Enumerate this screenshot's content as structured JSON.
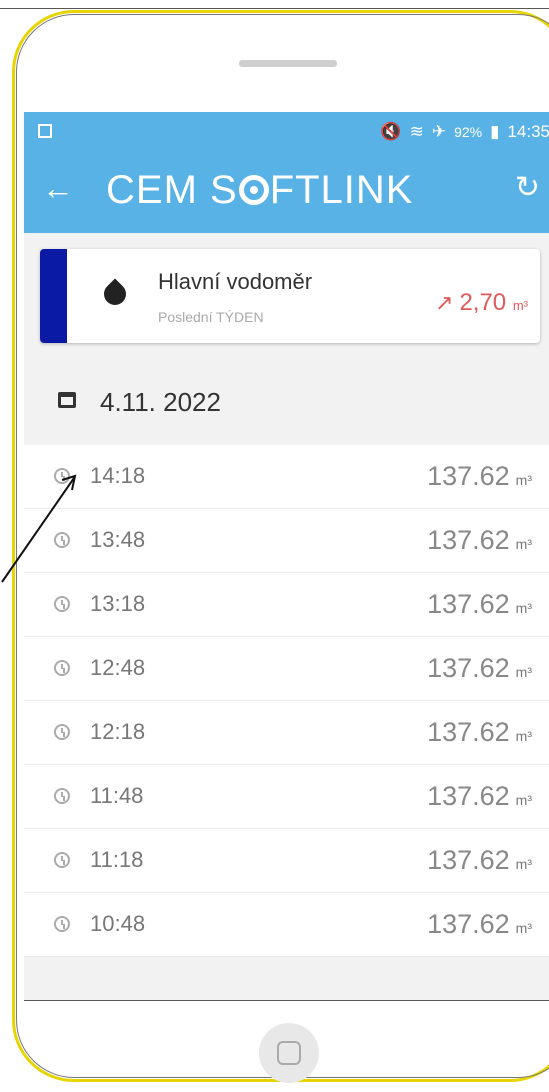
{
  "statusbar": {
    "signal_text": "92%",
    "time": "14:35"
  },
  "appbar": {
    "back_icon": "arrow-left-icon",
    "logo": "CEM SOFTLINK",
    "refresh_icon": "refresh-icon"
  },
  "meter": {
    "name": "Hlavní vodoměr",
    "period": "Poslední TÝDEN",
    "value": "2,70",
    "unit": "m³",
    "accent": "#0a1aa5",
    "trend_color": "#e05a5a"
  },
  "date": "4.11. 2022",
  "readings": [
    {
      "time": "14:18",
      "value": "137.62",
      "unit": "m³"
    },
    {
      "time": "13:48",
      "value": "137.62",
      "unit": "m³"
    },
    {
      "time": "13:18",
      "value": "137.62",
      "unit": "m³"
    },
    {
      "time": "12:48",
      "value": "137.62",
      "unit": "m³"
    },
    {
      "time": "12:18",
      "value": "137.62",
      "unit": "m³"
    },
    {
      "time": "11:48",
      "value": "137.62",
      "unit": "m³"
    },
    {
      "time": "11:18",
      "value": "137.62",
      "unit": "m³"
    },
    {
      "time": "10:48",
      "value": "137.62",
      "unit": "m³"
    }
  ]
}
